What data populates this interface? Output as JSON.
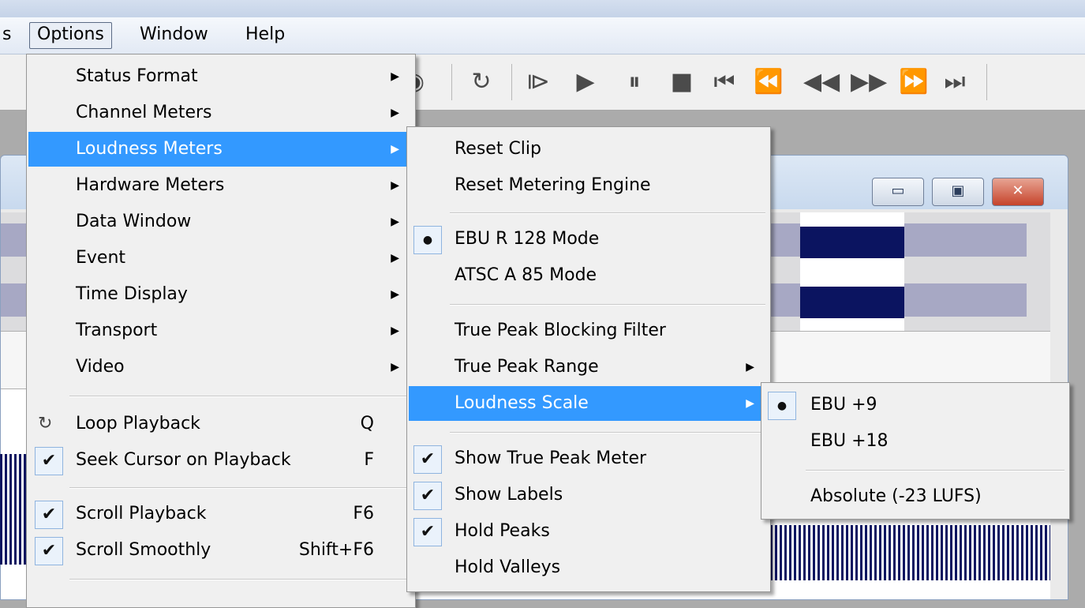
{
  "menubar": {
    "partial": "s",
    "items": [
      "Options",
      "Window",
      "Help"
    ]
  },
  "options_menu": {
    "items": [
      {
        "label": "Status Format",
        "submenu": true
      },
      {
        "label": "Channel Meters",
        "submenu": true
      },
      {
        "label": "Loudness Meters",
        "submenu": true,
        "highlighted": true
      },
      {
        "label": "Hardware Meters",
        "submenu": true
      },
      {
        "label": "Data Window",
        "submenu": true
      },
      {
        "label": "Event",
        "submenu": true
      },
      {
        "label": "Time Display",
        "submenu": true
      },
      {
        "label": "Transport",
        "submenu": true
      },
      {
        "label": "Video",
        "submenu": true
      }
    ],
    "toggles": [
      {
        "label": "Loop Playback",
        "shortcut": "Q",
        "icon": "loop-icon"
      },
      {
        "label": "Seek Cursor on Playback",
        "shortcut": "F",
        "checked": true
      },
      {
        "label": "Scroll Playback",
        "shortcut": "F6",
        "checked": true
      },
      {
        "label": "Scroll Smoothly",
        "shortcut": "Shift+F6",
        "checked": true
      }
    ]
  },
  "loudness_menu": {
    "items": [
      {
        "label": "Reset Clip"
      },
      {
        "label": "Reset Metering Engine"
      },
      {
        "label": "EBU R 128 Mode",
        "radio": true
      },
      {
        "label": "ATSC A 85 Mode"
      },
      {
        "label": "True Peak Blocking Filter"
      },
      {
        "label": "True Peak Range",
        "submenu": true
      },
      {
        "label": "Loudness Scale",
        "submenu": true,
        "highlighted": true
      },
      {
        "label": "Show True Peak Meter",
        "checked": true
      },
      {
        "label": "Show Labels",
        "checked": true
      },
      {
        "label": "Hold Peaks",
        "checked": true
      },
      {
        "label": "Hold Valleys"
      }
    ]
  },
  "scale_menu": {
    "items": [
      {
        "label": "EBU +9",
        "radio": true
      },
      {
        "label": "EBU +18"
      },
      {
        "label": "Absolute (-23 LUFS)"
      }
    ]
  },
  "symbols": {
    "arrow": "▶",
    "check": "✔",
    "dot": "●",
    "loop": "↻"
  },
  "colors": {
    "highlight": "#3399ff",
    "waveform": "#0b1460",
    "waveform_light": "#a7a8c4"
  }
}
